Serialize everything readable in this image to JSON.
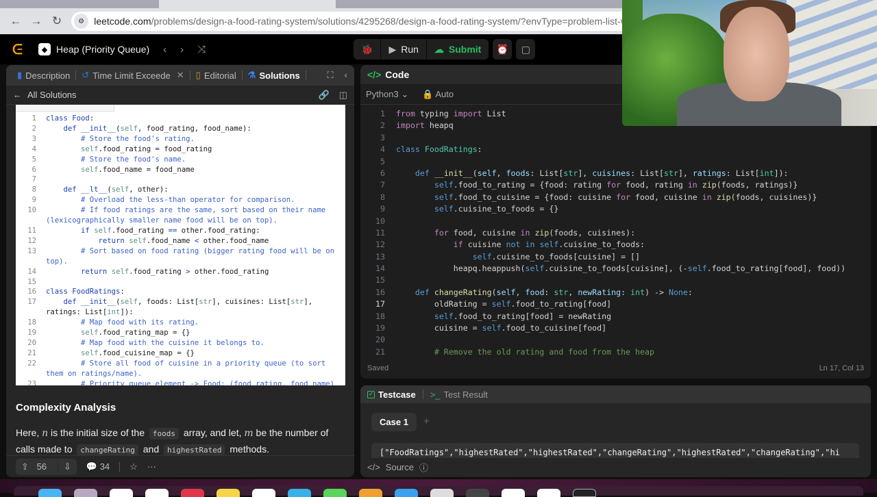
{
  "browser": {
    "url_host": "leetcode.com",
    "url_path": "/problems/design-a-food-rating-system/solutions/4295268/design-a-food-rating-system/?envType=problem-list-v2&env"
  },
  "appbar": {
    "problem_list": "Heap (Priority Queue)",
    "run_label": "Run",
    "submit_label": "Submit"
  },
  "left": {
    "tabs": [
      "Description",
      "Time Limit Exceede",
      "Editorial",
      "Solutions"
    ],
    "all_solutions": "All Solutions",
    "code_lines": [
      {
        "n": "1",
        "h": "<span class='cl'>class Food</span>:"
      },
      {
        "n": "2",
        "h": "    <span class='kw'>def</span> <span class='kw'>__init__</span>(<span class='sf'>self</span>, food_rating, food_name):"
      },
      {
        "n": "3",
        "h": "        <span class='cm'># Store the food's rating.</span>"
      },
      {
        "n": "4",
        "h": "        <span class='sf'>self</span>.food_rating = food_rating"
      },
      {
        "n": "5",
        "h": "        <span class='cm'># Store the food's name.</span>"
      },
      {
        "n": "6",
        "h": "        <span class='sf'>self</span>.food_name = food_name"
      },
      {
        "n": "7",
        "h": ""
      },
      {
        "n": "8",
        "h": "    <span class='kw'>def</span> <span class='kw'>__lt__</span>(<span class='sf'>self</span>, other):"
      },
      {
        "n": "9",
        "h": "        <span class='cm'># Overload the less-than operator for comparison.</span>"
      },
      {
        "n": "10",
        "h": "        <span class='cm'># If food ratings are the same, sort based on their name (lexicographically smaller name food will be on top).</span>"
      },
      {
        "n": "11",
        "h": "        <span class='kw'>if</span> <span class='sf'>self</span>.food_rating <span class='kw'>==</span> other.food_rating:"
      },
      {
        "n": "12",
        "h": "            <span class='kw'>return</span> <span class='sf'>self</span>.food_name <span class='kw'>&lt;</span> other.food_name"
      },
      {
        "n": "13",
        "h": "        <span class='cm'># Sort based on food rating (bigger rating food will be on top).</span>"
      },
      {
        "n": "14",
        "h": "        <span class='kw'>return</span> <span class='sf'>self</span>.food_rating <span class='kw'>&gt;</span> other.food_rating"
      },
      {
        "n": "15",
        "h": ""
      },
      {
        "n": "16",
        "h": "<span class='cl'>class FoodRatings</span>:"
      },
      {
        "n": "17",
        "h": "    <span class='kw'>def</span> <span class='kw'>__init__</span>(<span class='sf'>self</span>, foods: List[<span class='sf'>str</span>], cuisines: List[<span class='sf'>str</span>], ratings: List[<span class='sf'>int</span>]):"
      },
      {
        "n": "18",
        "h": "        <span class='cm'># Map food with its rating.</span>"
      },
      {
        "n": "19",
        "h": "        <span class='sf'>self</span>.food_rating_map = {}"
      },
      {
        "n": "20",
        "h": "        <span class='cm'># Map food with the cuisine it belongs to.</span>"
      },
      {
        "n": "21",
        "h": "        <span class='sf'>self</span>.food_cuisine_map = {}"
      },
      {
        "n": "22",
        "h": "        <span class='cm'># Store all food of cuisine in a priority queue (to sort them on ratings/name).</span>"
      },
      {
        "n": "23",
        "h": "        <span class='cm'># Priority queue element -&gt; Food: (food_rating, food_name)</span>"
      }
    ],
    "complexity_title": "Complexity Analysis",
    "para": {
      "p1": "Here, ",
      "n": "n",
      "p2": " is the initial size of the ",
      "c1": "foods",
      "p3": " array, and let, ",
      "m": "m",
      "p4": " be the number of calls made to ",
      "c2": "changeRating",
      "p5": " and ",
      "c3": "highestRated",
      "p6": " methods."
    },
    "upvotes": "56",
    "comments": "34"
  },
  "right": {
    "title": "Code",
    "language": "Python3",
    "mode": "Auto",
    "current_line": "17",
    "code_lines": [
      {
        "n": "1",
        "h": "<span class='k'>from</span> typing <span class='k'>import</span> List"
      },
      {
        "n": "2",
        "h": "<span class='k'>import</span> heapq"
      },
      {
        "n": "3",
        "h": ""
      },
      {
        "n": "4",
        "h": "<span class='d'>class</span> <span class='c'>FoodRatings</span>:"
      },
      {
        "n": "5",
        "h": ""
      },
      {
        "n": "6",
        "h": "    <span class='d'>def</span> <span class='f'>__init__</span>(<span class='p'>self</span>, <span class='p'>foods</span>: List[<span class='t'>str</span>], <span class='p'>cuisines</span>: List[<span class='t'>str</span>], <span class='p'>ratings</span>: List[<span class='t'>int</span>]):"
      },
      {
        "n": "7",
        "h": "        <span class='s'>self</span>.food_to_rating = {food: rating <span class='k'>for</span> food, rating <span class='k'>in</span> <span class='f'>zip</span>(foods, ratings)}"
      },
      {
        "n": "8",
        "h": "        <span class='s'>self</span>.food_to_cuisine = {food: cuisine <span class='k'>for</span> food, cuisine <span class='k'>in</span> <span class='f'>zip</span>(foods, cuisines)}"
      },
      {
        "n": "9",
        "h": "        <span class='s'>self</span>.cuisine_to_foods = {}"
      },
      {
        "n": "10",
        "h": ""
      },
      {
        "n": "11",
        "h": "        <span class='k'>for</span> food, cuisine <span class='k'>in</span> <span class='f'>zip</span>(foods, cuisines):"
      },
      {
        "n": "12",
        "h": "            <span class='k'>if</span> cuisine <span class='d'>not</span> <span class='d'>in</span> <span class='s'>self</span>.cuisine_to_foods:"
      },
      {
        "n": "13",
        "h": "                <span class='s'>self</span>.cuisine_to_foods[cuisine] = []"
      },
      {
        "n": "14",
        "h": "            heapq.heappush(<span class='s'>self</span>.cuisine_to_foods[cuisine], (-<span class='s'>self</span>.food_to_rating[food], food))"
      },
      {
        "n": "15",
        "h": ""
      },
      {
        "n": "16",
        "h": "    <span class='d'>def</span> <span class='f'>changeRating</span>(<span class='p'>self</span>, <span class='p'>food</span>: <span class='t'>str</span>, <span class='p'>newRating</span>: <span class='t'>int</span>) -&gt; <span class='d'>None</span>:"
      },
      {
        "n": "17",
        "h": "        oldRating = <span class='s'>self</span>.food_to_rating[food]"
      },
      {
        "n": "18",
        "h": "        <span class='s'>self</span>.food_to_rating[food] = newRating"
      },
      {
        "n": "19",
        "h": "        cuisine = <span class='s'>self</span>.food_to_cuisine[food]"
      },
      {
        "n": "20",
        "h": ""
      },
      {
        "n": "21",
        "h": "        <span class='g'># Remove the old rating and food from the heap</span>"
      }
    ],
    "saved": "Saved",
    "cursor": "Ln 17, Col 13"
  },
  "test": {
    "tab_testcase": "Testcase",
    "tab_result": "Test Result",
    "case": "Case 1",
    "input": "[\"FoodRatings\",\"highestRated\",\"highestRated\",\"changeRating\",\"highestRated\",\"changeRating\",\"hi",
    "source": "Source"
  },
  "colors": {
    "accent": "#ffa116",
    "submit": "#2cbb5d",
    "active_tab_icon": "#3b82f6"
  }
}
